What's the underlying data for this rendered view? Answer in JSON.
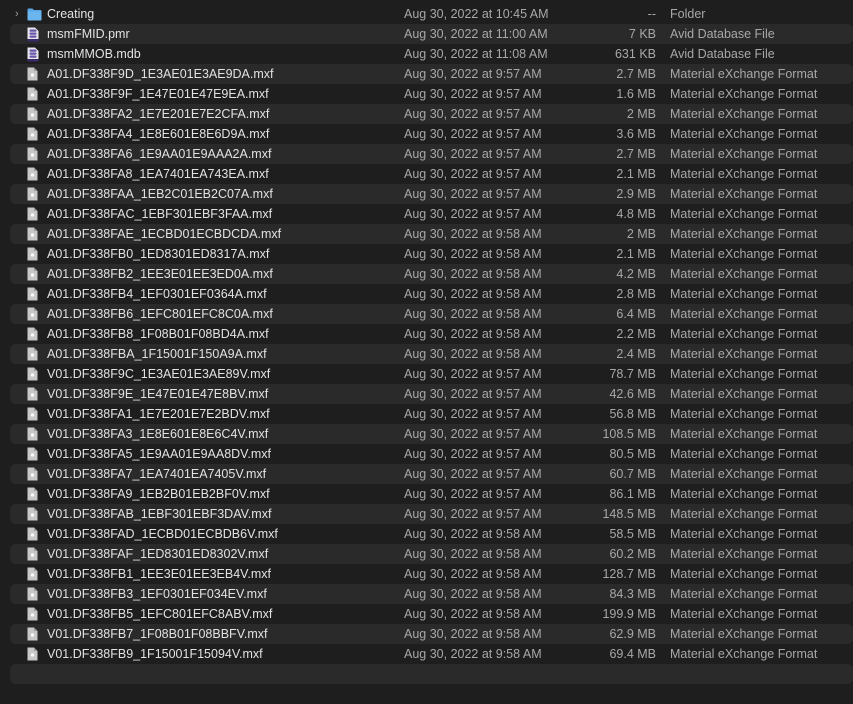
{
  "window": {
    "view": "list",
    "colors": {
      "background": "#1e1e1e",
      "stripe": "#2a2a2a",
      "name_text": "#e2e2e2",
      "meta_text": "#a8a8a8",
      "folder_icon": "#5aa8e8",
      "database_icon": "#6a56a8",
      "document_icon": "#c8c8c8"
    }
  },
  "files": [
    {
      "name": "Creating",
      "date": "Aug 30, 2022 at 10:45 AM",
      "size": "--",
      "kind": "Folder",
      "icon": "folder-icon",
      "expandable": true
    },
    {
      "name": "msmFMID.pmr",
      "date": "Aug 30, 2022 at 11:00 AM",
      "size": "7 KB",
      "kind": "Avid Database File",
      "icon": "database-file-icon"
    },
    {
      "name": "msmMMOB.mdb",
      "date": "Aug 30, 2022 at 11:08 AM",
      "size": "631 KB",
      "kind": "Avid Database File",
      "icon": "database-file-icon"
    },
    {
      "name": "A01.DF338F9D_1E3AE01E3AE9DA.mxf",
      "date": "Aug 30, 2022 at 9:57 AM",
      "size": "2.7 MB",
      "kind": "Material eXchange Format",
      "icon": "document-icon"
    },
    {
      "name": "A01.DF338F9F_1E47E01E47E9EA.mxf",
      "date": "Aug 30, 2022 at 9:57 AM",
      "size": "1.6 MB",
      "kind": "Material eXchange Format",
      "icon": "document-icon"
    },
    {
      "name": "A01.DF338FA2_1E7E201E7E2CFA.mxf",
      "date": "Aug 30, 2022 at 9:57 AM",
      "size": "2 MB",
      "kind": "Material eXchange Format",
      "icon": "document-icon"
    },
    {
      "name": "A01.DF338FA4_1E8E601E8E6D9A.mxf",
      "date": "Aug 30, 2022 at 9:57 AM",
      "size": "3.6 MB",
      "kind": "Material eXchange Format",
      "icon": "document-icon"
    },
    {
      "name": "A01.DF338FA6_1E9AA01E9AAA2A.mxf",
      "date": "Aug 30, 2022 at 9:57 AM",
      "size": "2.7 MB",
      "kind": "Material eXchange Format",
      "icon": "document-icon"
    },
    {
      "name": "A01.DF338FA8_1EA7401EA743EA.mxf",
      "date": "Aug 30, 2022 at 9:57 AM",
      "size": "2.1 MB",
      "kind": "Material eXchange Format",
      "icon": "document-icon"
    },
    {
      "name": "A01.DF338FAA_1EB2C01EB2C07A.mxf",
      "date": "Aug 30, 2022 at 9:57 AM",
      "size": "2.9 MB",
      "kind": "Material eXchange Format",
      "icon": "document-icon"
    },
    {
      "name": "A01.DF338FAC_1EBF301EBF3FAA.mxf",
      "date": "Aug 30, 2022 at 9:57 AM",
      "size": "4.8 MB",
      "kind": "Material eXchange Format",
      "icon": "document-icon"
    },
    {
      "name": "A01.DF338FAE_1ECBD01ECBDCDA.mxf",
      "date": "Aug 30, 2022 at 9:58 AM",
      "size": "2 MB",
      "kind": "Material eXchange Format",
      "icon": "document-icon"
    },
    {
      "name": "A01.DF338FB0_1ED8301ED8317A.mxf",
      "date": "Aug 30, 2022 at 9:58 AM",
      "size": "2.1 MB",
      "kind": "Material eXchange Format",
      "icon": "document-icon"
    },
    {
      "name": "A01.DF338FB2_1EE3E01EE3ED0A.mxf",
      "date": "Aug 30, 2022 at 9:58 AM",
      "size": "4.2 MB",
      "kind": "Material eXchange Format",
      "icon": "document-icon"
    },
    {
      "name": "A01.DF338FB4_1EF0301EF0364A.mxf",
      "date": "Aug 30, 2022 at 9:58 AM",
      "size": "2.8 MB",
      "kind": "Material eXchange Format",
      "icon": "document-icon"
    },
    {
      "name": "A01.DF338FB6_1EFC801EFC8C0A.mxf",
      "date": "Aug 30, 2022 at 9:58 AM",
      "size": "6.4 MB",
      "kind": "Material eXchange Format",
      "icon": "document-icon"
    },
    {
      "name": "A01.DF338FB8_1F08B01F08BD4A.mxf",
      "date": "Aug 30, 2022 at 9:58 AM",
      "size": "2.2 MB",
      "kind": "Material eXchange Format",
      "icon": "document-icon"
    },
    {
      "name": "A01.DF338FBA_1F15001F150A9A.mxf",
      "date": "Aug 30, 2022 at 9:58 AM",
      "size": "2.4 MB",
      "kind": "Material eXchange Format",
      "icon": "document-icon"
    },
    {
      "name": "V01.DF338F9C_1E3AE01E3AE89V.mxf",
      "date": "Aug 30, 2022 at 9:57 AM",
      "size": "78.7 MB",
      "kind": "Material eXchange Format",
      "icon": "document-icon"
    },
    {
      "name": "V01.DF338F9E_1E47E01E47E8BV.mxf",
      "date": "Aug 30, 2022 at 9:57 AM",
      "size": "42.6 MB",
      "kind": "Material eXchange Format",
      "icon": "document-icon"
    },
    {
      "name": "V01.DF338FA1_1E7E201E7E2BDV.mxf",
      "date": "Aug 30, 2022 at 9:57 AM",
      "size": "56.8 MB",
      "kind": "Material eXchange Format",
      "icon": "document-icon"
    },
    {
      "name": "V01.DF338FA3_1E8E601E8E6C4V.mxf",
      "date": "Aug 30, 2022 at 9:57 AM",
      "size": "108.5 MB",
      "kind": "Material eXchange Format",
      "icon": "document-icon"
    },
    {
      "name": "V01.DF338FA5_1E9AA01E9AA8DV.mxf",
      "date": "Aug 30, 2022 at 9:57 AM",
      "size": "80.5 MB",
      "kind": "Material eXchange Format",
      "icon": "document-icon"
    },
    {
      "name": "V01.DF338FA7_1EA7401EA7405V.mxf",
      "date": "Aug 30, 2022 at 9:57 AM",
      "size": "60.7 MB",
      "kind": "Material eXchange Format",
      "icon": "document-icon"
    },
    {
      "name": "V01.DF338FA9_1EB2B01EB2BF0V.mxf",
      "date": "Aug 30, 2022 at 9:57 AM",
      "size": "86.1 MB",
      "kind": "Material eXchange Format",
      "icon": "document-icon"
    },
    {
      "name": "V01.DF338FAB_1EBF301EBF3DAV.mxf",
      "date": "Aug 30, 2022 at 9:57 AM",
      "size": "148.5 MB",
      "kind": "Material eXchange Format",
      "icon": "document-icon"
    },
    {
      "name": "V01.DF338FAD_1ECBD01ECBDB6V.mxf",
      "date": "Aug 30, 2022 at 9:58 AM",
      "size": "58.5 MB",
      "kind": "Material eXchange Format",
      "icon": "document-icon"
    },
    {
      "name": "V01.DF338FAF_1ED8301ED8302V.mxf",
      "date": "Aug 30, 2022 at 9:58 AM",
      "size": "60.2 MB",
      "kind": "Material eXchange Format",
      "icon": "document-icon"
    },
    {
      "name": "V01.DF338FB1_1EE3E01EE3EB4V.mxf",
      "date": "Aug 30, 2022 at 9:58 AM",
      "size": "128.7 MB",
      "kind": "Material eXchange Format",
      "icon": "document-icon"
    },
    {
      "name": "V01.DF338FB3_1EF0301EF034EV.mxf",
      "date": "Aug 30, 2022 at 9:58 AM",
      "size": "84.3 MB",
      "kind": "Material eXchange Format",
      "icon": "document-icon"
    },
    {
      "name": "V01.DF338FB5_1EFC801EFC8ABV.mxf",
      "date": "Aug 30, 2022 at 9:58 AM",
      "size": "199.9 MB",
      "kind": "Material eXchange Format",
      "icon": "document-icon"
    },
    {
      "name": "V01.DF338FB7_1F08B01F08BBFV.mxf",
      "date": "Aug 30, 2022 at 9:58 AM",
      "size": "62.9 MB",
      "kind": "Material eXchange Format",
      "icon": "document-icon"
    },
    {
      "name": "V01.DF338FB9_1F15001F15094V.mxf",
      "date": "Aug 30, 2022 at 9:58 AM",
      "size": "69.4 MB",
      "kind": "Material eXchange Format",
      "icon": "document-icon"
    }
  ]
}
